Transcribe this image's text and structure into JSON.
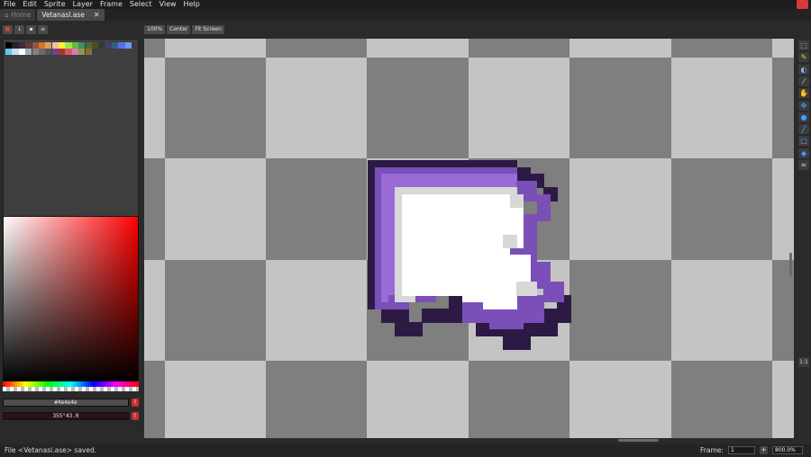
{
  "menu": [
    "File",
    "Edit",
    "Sprite",
    "Layer",
    "Frame",
    "Select",
    "View",
    "Help"
  ],
  "tabs": [
    {
      "label": "Home",
      "icon": "home-icon"
    },
    {
      "label": "Vetanasl.ase",
      "close": "✕"
    }
  ],
  "palette_tools": [
    "red-lock-icon",
    "arrow-down-icon",
    "save-icon",
    "menu-icon"
  ],
  "palette_colors": [
    "#000000",
    "#222034",
    "#45283c",
    "#663931",
    "#8f563b",
    "#df7126",
    "#d9a066",
    "#eec39a",
    "#fbf236",
    "#99e550",
    "#6abe30",
    "#37946e",
    "#4b692f",
    "#524b24",
    "#323c39",
    "#3f3f74",
    "#306082",
    "#5b6ee1",
    "#639bff",
    "#5fcde4",
    "#cbdbfc",
    "#ffffff",
    "#9badb7",
    "#847e87",
    "#696a6a",
    "#595652",
    "#76428a",
    "#ac3232",
    "#d95763",
    "#d77bba",
    "#8f974a",
    "#8a6f30"
  ],
  "color": {
    "hex": "#4e4e4e",
    "hsv": "355°43.0",
    "warn": "!"
  },
  "canvas_toolbar": [
    "100%",
    "Center",
    "Fit Screen"
  ],
  "tools": [
    "marquee-icon",
    "pencil-icon",
    "eraser-icon",
    "eyedropper-icon",
    "hand-icon",
    "move-icon",
    "drop-icon",
    "line-icon",
    "rectangle-icon",
    "fill-icon",
    "blur-icon"
  ],
  "tool_bottom": "1:1",
  "status": {
    "text": "File <Vetanasl.ase> saved.",
    "frame_label": "Frame:",
    "frame_value": "1",
    "add": "+",
    "zoom": "800.0%"
  },
  "colors": {
    "checker_light": "#c4c4c4",
    "checker_dark": "#7f7f7f",
    "outline_dark": "#2d1a44",
    "purple_mid": "#7a4fb8",
    "purple_light": "#9a6bd6",
    "white": "#ffffff",
    "shade": "#d8d8d8"
  }
}
